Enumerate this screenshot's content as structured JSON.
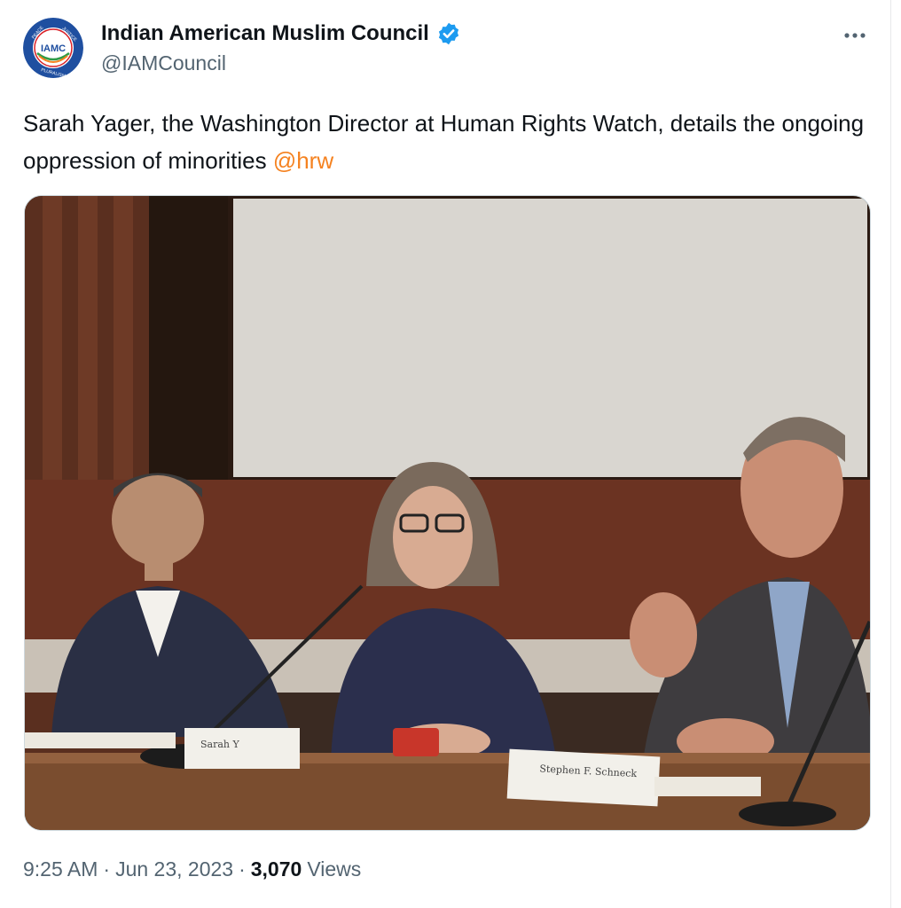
{
  "author": {
    "display_name": "Indian American Muslim Council",
    "handle": "@IAMCouncil",
    "verified": true,
    "verified_color": "#1d9bf0",
    "avatar": {
      "center_text": "IAMC",
      "ring_words": [
        "PEACE",
        "JUSTICE",
        "PLURALISM"
      ],
      "ring_color": "#1f4fa0",
      "accent_color": "#d92027"
    }
  },
  "more_icon": "more-horizontal-icon",
  "tweet": {
    "text": "Sarah Yager, the Washington Director at Human Rights Watch, details the ongoing oppression of minorities ",
    "mention": "@hrw",
    "mention_color": "#f58220"
  },
  "media": {
    "placards": {
      "left": "Sarah Y",
      "right": "Stephen F. Schneck"
    }
  },
  "meta": {
    "time": "9:25 AM",
    "date": "Jun 23, 2023",
    "separator": "·",
    "views_count": "3,070",
    "views_label": "Views"
  }
}
